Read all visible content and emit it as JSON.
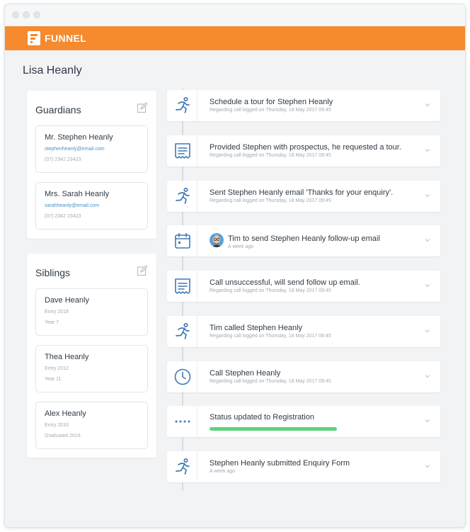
{
  "app": {
    "brand": "FUNNEL",
    "accent": "#f58a2f"
  },
  "page": {
    "title": "Lisa Heanly"
  },
  "guardians": {
    "title": "Guardians",
    "edit_icon": "edit-icon",
    "items": [
      {
        "name": "Mr. Stephen Heanly",
        "email": "stephenheanly@email.com",
        "phone": "(07) 2342 23423"
      },
      {
        "name": "Mrs. Sarah Heanly",
        "email": "sarahheanly@email.com",
        "phone": "(07) 2342 23423"
      }
    ]
  },
  "siblings": {
    "title": "Siblings",
    "edit_icon": "edit-icon",
    "items": [
      {
        "name": "Dave Heanly",
        "line1": "Entry 2018",
        "line2": "Year 7"
      },
      {
        "name": "Thea Heanly",
        "line1": "Entry 2012",
        "line2": "Year 11"
      },
      {
        "name": "Alex Heanly",
        "line1": "Entry 2010",
        "line2": "Graduated 2016"
      }
    ]
  },
  "timeline": {
    "events": [
      {
        "icon": "runner-icon",
        "title": "Schedule a tour for Stephen Heanly",
        "subtitle": "Regarding call logged on Thursday, 18 May 2017 09:45"
      },
      {
        "icon": "note-icon",
        "title": "Provided Stephen with prospectus, he requested a tour.",
        "subtitle": "Regarding call logged on Thursday, 18 May 2017 09:45"
      },
      {
        "icon": "runner-icon",
        "title": "Sent Stephen Heanly email 'Thanks for your enquiry'.",
        "subtitle": "Regarding call logged on Thursday, 18 May 2017 09:45"
      },
      {
        "icon": "calendar-icon",
        "title": "Tim to send Stephen Heanly follow-up email",
        "subtitle": "A week ago",
        "avatar": "avatar-icon"
      },
      {
        "icon": "note-icon",
        "title": "Call unsuccessful, will send follow up email.",
        "subtitle": "Regarding call logged on Thursday, 18 May 2017 09:45"
      },
      {
        "icon": "runner-icon",
        "title": "Tim called Stephen Heanly",
        "subtitle": "Regarding call logged on Thursday, 18 May 2017 09:45"
      },
      {
        "icon": "clock-icon",
        "title": "Call Stephen Heanly",
        "subtitle": "Regarding call logged on Thursday, 18 May 2017 09:45"
      },
      {
        "icon": "dots-icon",
        "title": "Status updated to Registration",
        "status_color": "#5fd17e"
      },
      {
        "icon": "runner-icon",
        "title": "Stephen Heanly submitted Enquiry Form",
        "subtitle": "A week ago"
      }
    ]
  },
  "colors": {
    "icon": "#3f78b5",
    "text": "#2f3a45",
    "muted": "#a3aab2",
    "link": "#4a90c8"
  }
}
